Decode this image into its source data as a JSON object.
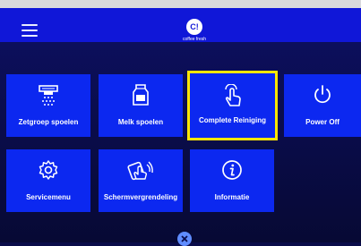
{
  "header": {
    "menu_icon": "hamburger-icon",
    "logo_monogram": "C!",
    "logo_text": "coffee fresh"
  },
  "tiles": [
    {
      "label": "Zetgroep spoelen",
      "icon": "brew-group-rinse-icon"
    },
    {
      "label": "Melk spoelen",
      "icon": "milk-carton-icon"
    },
    {
      "label": "Complete Reiniging",
      "icon": "touch-hand-icon",
      "selected": true
    },
    {
      "label": "Power Off",
      "icon": "power-icon"
    },
    {
      "label": "Servicemenu",
      "icon": "gear-icon"
    },
    {
      "label": "Schermvergrendeling",
      "icon": "screen-lock-hand-icon"
    },
    {
      "label": "Informatie",
      "icon": "info-icon"
    }
  ],
  "footer": {
    "close_icon": "close-icon"
  },
  "colors": {
    "tile": "#0c28f0",
    "topbar": "#1017d8",
    "background": "#0a0c4a",
    "selection": "#ffe600",
    "close": "#5f8cff"
  }
}
